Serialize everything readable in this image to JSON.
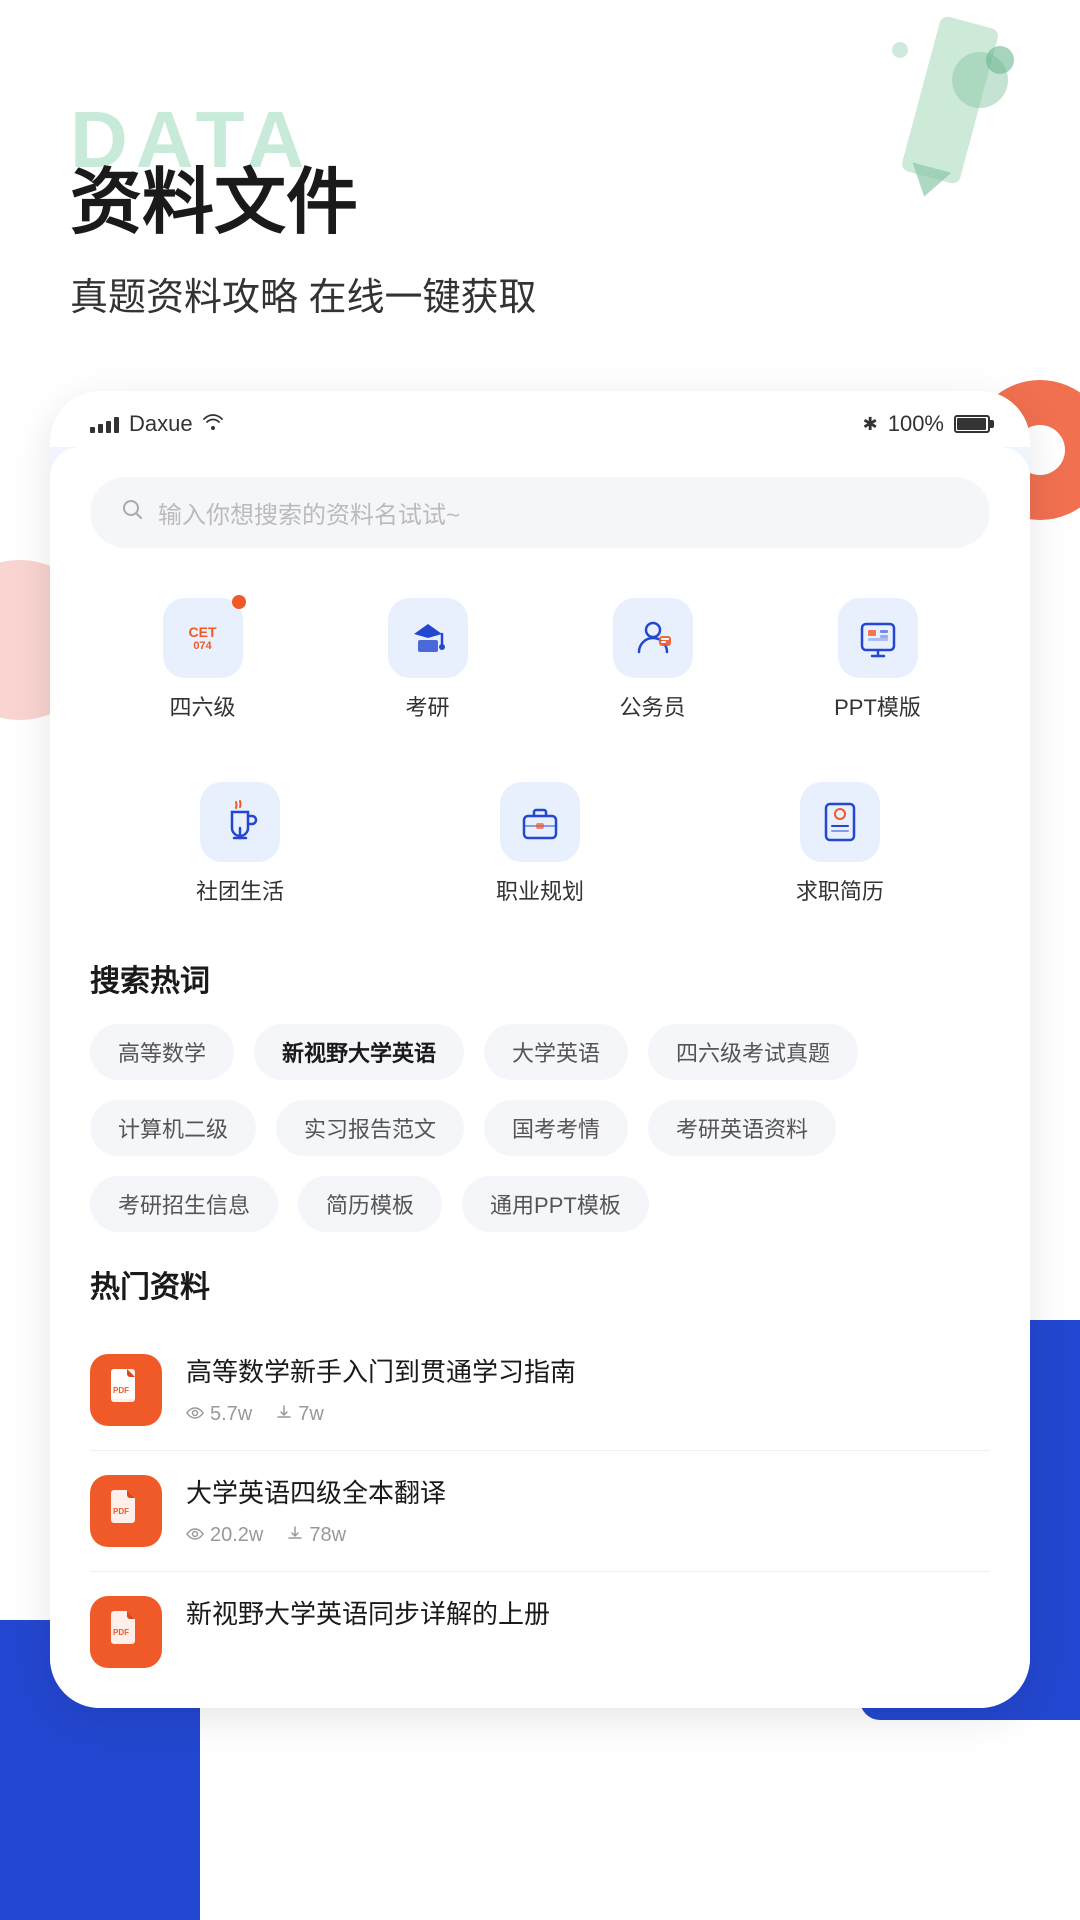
{
  "app": {
    "title": "资料文件",
    "subtitle": "真题资料攻略 在线一键获取",
    "bg_data_text": "DATA"
  },
  "status_bar": {
    "carrier": "Daxue",
    "battery_percent": "100%",
    "bluetooth": "✱"
  },
  "search": {
    "placeholder": "输入你想搜索的资料名试试~"
  },
  "categories_row1": [
    {
      "id": "cet",
      "label": "四六级",
      "icon_type": "cet"
    },
    {
      "id": "kaoyan",
      "label": "考研",
      "icon_type": "grad"
    },
    {
      "id": "civil",
      "label": "公务员",
      "icon_type": "person"
    },
    {
      "id": "ppt",
      "label": "PPT模版",
      "icon_type": "ppt"
    }
  ],
  "categories_row2": [
    {
      "id": "club",
      "label": "社团生活",
      "icon_type": "cup"
    },
    {
      "id": "career",
      "label": "职业规划",
      "icon_type": "briefcase"
    },
    {
      "id": "resume",
      "label": "求职简历",
      "icon_type": "resume"
    }
  ],
  "hot_search": {
    "title": "搜索热词",
    "tags": [
      {
        "text": "高等数学",
        "bold": false
      },
      {
        "text": "新视野大学英语",
        "bold": true
      },
      {
        "text": "大学英语",
        "bold": false
      },
      {
        "text": "四六级考试真题",
        "bold": false
      },
      {
        "text": "计算机二级",
        "bold": false
      },
      {
        "text": "实习报告范文",
        "bold": false
      },
      {
        "text": "国考考情",
        "bold": false
      },
      {
        "text": "考研英语资料",
        "bold": false
      },
      {
        "text": "考研招生信息",
        "bold": false
      },
      {
        "text": "简历模板",
        "bold": false
      },
      {
        "text": "通用PPT模板",
        "bold": false
      }
    ]
  },
  "hot_materials": {
    "title": "热门资料",
    "items": [
      {
        "title": "高等数学新手入门到贯通学习指南",
        "views": "5.7w",
        "downloads": "7w"
      },
      {
        "title": "大学英语四级全本翻译",
        "views": "20.2w",
        "downloads": "78w"
      },
      {
        "title": "新视野大学英语同步详解的上册",
        "views": "",
        "downloads": ""
      }
    ]
  },
  "colors": {
    "primary_blue": "#2347d0",
    "accent_orange": "#f05a28",
    "icon_bg": "#e8f0fe",
    "tag_bg": "#f5f6fa",
    "text_dark": "#1a1a1a",
    "text_mid": "#555555",
    "text_light": "#999999",
    "green_deco": "#c8ead8"
  }
}
